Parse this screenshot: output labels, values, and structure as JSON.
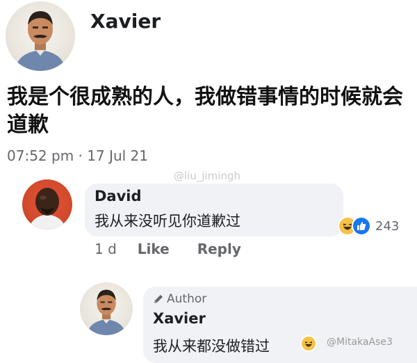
{
  "post": {
    "author": "Xavier",
    "text": "我是个很成熟的人，我做错事情的时候就会道歉",
    "timestamp": "07:52 pm · 17 Jul 21"
  },
  "watermarks": {
    "top": "@liu_jimingh",
    "bottom": "@MitakaAse3"
  },
  "comment": {
    "author": "David",
    "text": "我从来没听见你道歉过",
    "reaction_count": "243",
    "time": "1 d",
    "like_label": "Like",
    "reply_label": "Reply"
  },
  "reply": {
    "author_badge": "Author",
    "author": "Xavier",
    "text": "我从来都没做错过"
  },
  "icons": {
    "haha": "haha-reaction-icon",
    "like": "like-reaction-icon",
    "pencil": "pencil-icon"
  },
  "colors": {
    "like_blue": "#1877f2",
    "haha_yellow": "#f7c24a",
    "bubble_bg": "#f0f2f5",
    "meta_gray": "#65676b"
  }
}
